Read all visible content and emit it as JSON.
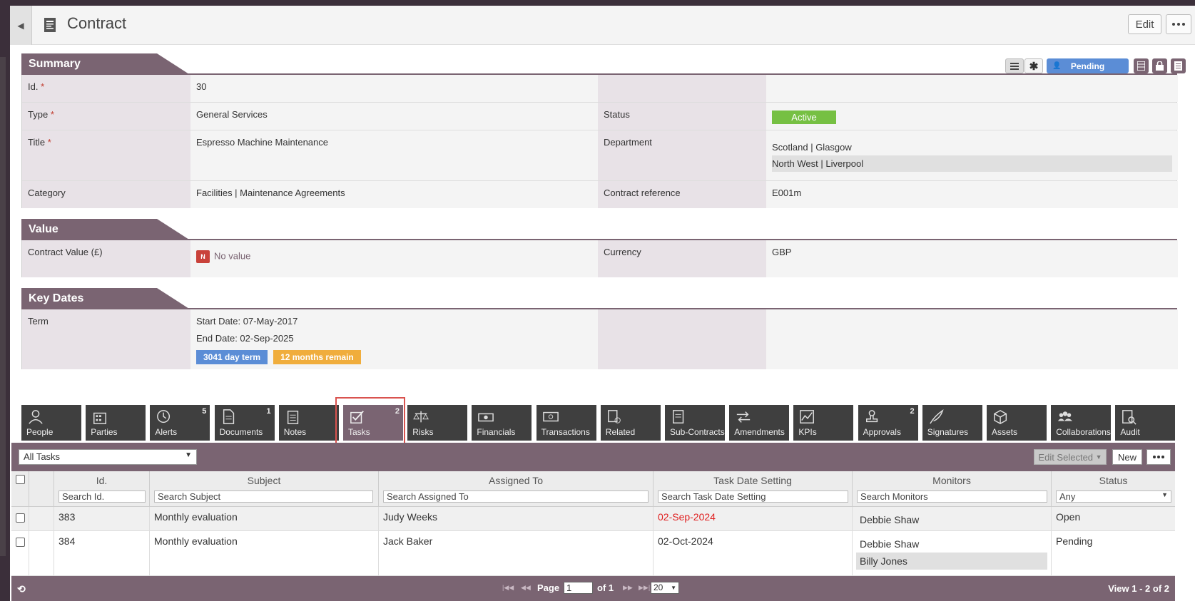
{
  "header": {
    "title": "Contract",
    "edit_label": "Edit"
  },
  "status_pill": "Pending",
  "sections": {
    "summary": "Summary",
    "value": "Value",
    "key_dates": "Key Dates"
  },
  "summary": {
    "id_label": "Id.",
    "id_value": "30",
    "type_label": "Type",
    "type_value": "General Services",
    "status_label": "Status",
    "status_value": "Active",
    "title_label": "Title",
    "title_value": "Espresso Machine Maintenance",
    "department_label": "Department",
    "department_values": [
      "Scotland | Glasgow",
      "North West | Liverpool"
    ],
    "category_label": "Category",
    "category_value": "Facilities | Maintenance Agreements",
    "ref_label": "Contract reference",
    "ref_value": "E001m",
    "req_mark": "*"
  },
  "value": {
    "cv_label": "Contract Value (£)",
    "no_badge": "N",
    "no_value": "No value",
    "currency_label": "Currency",
    "currency_value": "GBP"
  },
  "key_dates": {
    "term_label": "Term",
    "start": "Start Date: 07-May-2017",
    "end": "End Date: 02-Sep-2025",
    "term_badge": "3041 day term",
    "remain_badge": "12 months remain"
  },
  "tabs": [
    {
      "label": "People",
      "count": "",
      "icon": "person-icon"
    },
    {
      "label": "Parties",
      "count": "",
      "icon": "building-icon"
    },
    {
      "label": "Alerts",
      "count": "5",
      "icon": "clock-icon"
    },
    {
      "label": "Documents",
      "count": "1",
      "icon": "document-icon"
    },
    {
      "label": "Notes",
      "count": "",
      "icon": "notepad-icon"
    },
    {
      "label": "Tasks",
      "count": "2",
      "icon": "tasks-icon"
    },
    {
      "label": "Risks",
      "count": "",
      "icon": "scales-icon"
    },
    {
      "label": "Financials",
      "count": "",
      "icon": "cash-icon"
    },
    {
      "label": "Transactions",
      "count": "",
      "icon": "money-icon"
    },
    {
      "label": "Related",
      "count": "",
      "icon": "related-docs-icon"
    },
    {
      "label": "Sub-Contracts",
      "count": "",
      "icon": "subcontract-icon"
    },
    {
      "label": "Amendments",
      "count": "",
      "icon": "arrows-icon"
    },
    {
      "label": "KPIs",
      "count": "",
      "icon": "chart-icon"
    },
    {
      "label": "Approvals",
      "count": "2",
      "icon": "stamp-icon"
    },
    {
      "label": "Signatures",
      "count": "",
      "icon": "quill-icon"
    },
    {
      "label": "Assets",
      "count": "",
      "icon": "cube-icon"
    },
    {
      "label": "Collaborations",
      "count": "",
      "icon": "group-icon"
    },
    {
      "label": "Audit",
      "count": "",
      "icon": "audit-icon"
    }
  ],
  "tasks": {
    "filter": "All Tasks",
    "edit_selected": "Edit Selected",
    "new_label": "New",
    "columns": [
      "Id.",
      "Subject",
      "Assigned To",
      "Task Date Setting",
      "Monitors",
      "Status"
    ],
    "search_placeholders": [
      "Search Id.",
      "Search Subject",
      "Search Assigned To",
      "Search Task Date Setting",
      "Search Monitors"
    ],
    "status_filter": "Any",
    "rows": [
      {
        "id": "383",
        "subject": "Monthly evaluation",
        "assigned": "Judy Weeks",
        "date": "02-Sep-2024",
        "monitors": [
          "Debbie Shaw"
        ],
        "status": "Open"
      },
      {
        "id": "384",
        "subject": "Monthly evaluation",
        "assigned": "Jack Baker",
        "date": "02-Oct-2024",
        "monitors": [
          "Debbie Shaw",
          "Billy Jones"
        ],
        "status": "Pending"
      }
    ],
    "overdue_color": "#e02020"
  },
  "pager": {
    "page_label": "Page",
    "page_value": "1",
    "of_label": "of 1",
    "per_page": "20",
    "view": "View 1 - 2 of 2"
  }
}
